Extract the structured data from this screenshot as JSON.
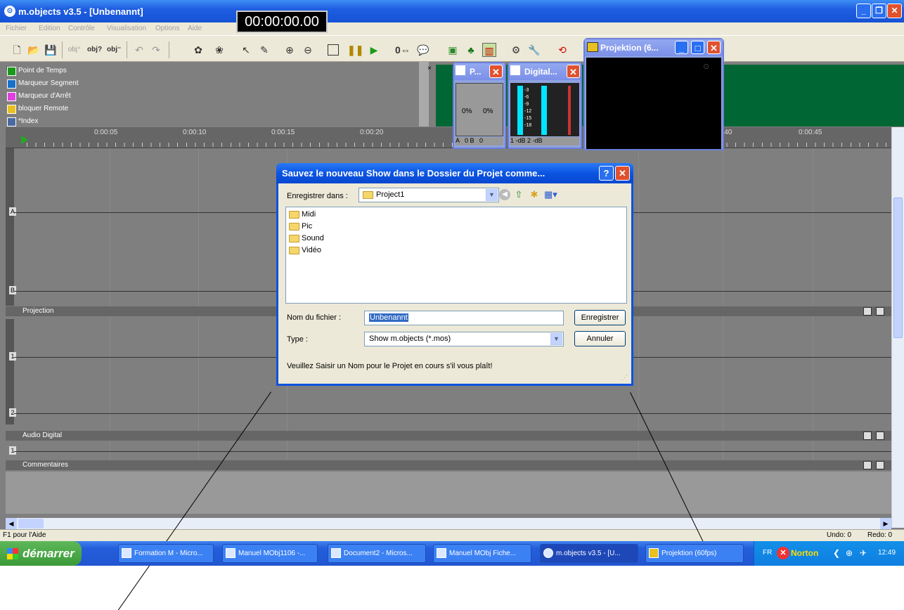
{
  "window": {
    "title": "m.objects v3.5 - [Unbenannt]",
    "app_icon": "m-objects-logo-icon"
  },
  "menu": [
    "Fichier",
    "Edition",
    "Contrôle",
    "Visualisation",
    "Options",
    "Aide"
  ],
  "timer": "00:00:00.00",
  "legend": [
    "Point de Temps",
    "Marqueur Segment",
    "Marqueur d'Arrêt",
    "bloquer Remote",
    "*Index"
  ],
  "ruler": {
    "ticks": [
      "0:00:05",
      "0:00:10",
      "0:00:15",
      "0:00:20",
      "0:00:40",
      "0:00:45"
    ]
  },
  "tracks": {
    "projection": "Projection",
    "audio": "Audio Digital",
    "comments": "Commentaires",
    "labels": [
      "A",
      "B",
      "1",
      "2",
      "1"
    ]
  },
  "float_windows": {
    "proj_small": {
      "title": "P...",
      "pct_a": "0%",
      "pct_b": "0%",
      "ab": "A   0 B   0"
    },
    "digital": {
      "title": "Digital...",
      "footer": "1 -dB 2 -dB",
      "scale": [
        "-3",
        "-6",
        "-9",
        "-12",
        "-15",
        "-18"
      ]
    },
    "projektion": {
      "title": "Projektion (6..."
    }
  },
  "dialog": {
    "title": "Sauvez le nouveau Show dans le Dossier du Projet comme...",
    "save_in_label": "Enregistrer dans :",
    "save_in_value": "Project1",
    "folders": [
      "Midi",
      "Pic",
      "Sound",
      "Vidéo"
    ],
    "filename_label": "Nom du fichier :",
    "filename_value": "Unbenannt",
    "type_label": "Type :",
    "type_value": "Show m.objects (*.mos)",
    "save_button": "Enregistrer",
    "cancel_button": "Annuler",
    "hint": "Veuillez Saisir un Nom pour le Projet en cours  s'il vous plaît!"
  },
  "status": {
    "help": "F1 pour l'Aide",
    "undo": "Undo: 0",
    "redo": "Redo: 0"
  },
  "taskbar": {
    "start": "démarrer",
    "tasks": [
      "Formation M - Micro...",
      "Manuel MObj1106 -...",
      "Document2 - Micros...",
      "Manuel MObj Fiche...",
      "m.objects v3.5 - [U...",
      "Projektion (60fps)"
    ],
    "lang": "FR",
    "norton": "Norton",
    "clock": "12:49"
  },
  "colors": {
    "titlebar": "#1f5ee0",
    "dialog_border": "#0a53e0",
    "track_bg": "#7f7f7f",
    "green_panel": "#006633",
    "meter": "#00e5ff"
  }
}
